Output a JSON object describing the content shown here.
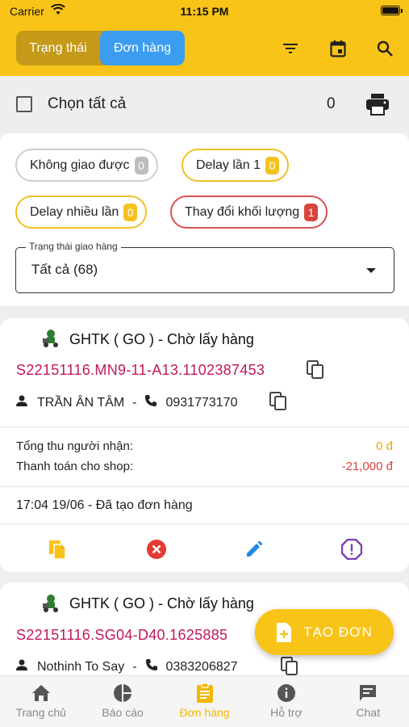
{
  "status_bar": {
    "carrier": "Carrier",
    "time": "11:15 PM"
  },
  "header": {
    "segments": [
      {
        "label": "Trạng thái",
        "active": false
      },
      {
        "label": "Đơn hàng",
        "active": true
      }
    ],
    "icons": [
      "filter-icon",
      "calendar-icon",
      "search-icon"
    ]
  },
  "select_bar": {
    "label": "Chọn tất cả",
    "count": "0"
  },
  "filters": {
    "chips": [
      {
        "label": "Không giao được",
        "count": "0",
        "color": "#bdbdbd"
      },
      {
        "label": "Delay lần 1",
        "count": "0",
        "color": "#f4c21c"
      },
      {
        "label": "Delay nhiều lần",
        "count": "0",
        "color": "#f4c21c"
      },
      {
        "label": "Thay đổi khối lượng",
        "count": "1",
        "color": "#d9443b"
      }
    ],
    "delivery_status": {
      "legend": "Trạng thái giao hàng",
      "value": "Tất cả (68)"
    }
  },
  "orders": [
    {
      "title": "GHTK ( GO ) - Chờ lấy hàng",
      "code": "S22151116.MN9-11-A13.1102387453",
      "customer": "TRẦN ÂN TÂM",
      "separator": "-",
      "phone": "0931773170",
      "collect_label": "Tổng thu người nhận:",
      "collect_value": "0 đ",
      "pay_label": "Thanh toán cho shop:",
      "pay_value": "-21,000 đ",
      "history": "17:04 19/06 - Đã tạo đơn hàng"
    },
    {
      "title": "GHTK ( GO ) - Chờ lấy hàng",
      "code": "S22151116.SG04-D40.1625885",
      "customer": "Nothinh To Say",
      "separator": "-",
      "phone": "0383206827"
    }
  ],
  "fab": {
    "label": "TẠO ĐƠN"
  },
  "bottom_nav": [
    {
      "label": "Trang chủ",
      "icon": "home-icon",
      "active": false
    },
    {
      "label": "Báo cáo",
      "icon": "pie-chart-icon",
      "active": false
    },
    {
      "label": "Đơn hàng",
      "icon": "clipboard-icon",
      "active": true
    },
    {
      "label": "Hỗ trợ",
      "icon": "info-icon",
      "active": false
    },
    {
      "label": "Chat",
      "icon": "chat-icon",
      "active": false
    }
  ],
  "colors": {
    "brand": "#f9c418",
    "segment_active": "#3a9df0",
    "order_code": "#c2185b",
    "amount_zero": "#f0a500",
    "amount_negative": "#d9443b"
  }
}
